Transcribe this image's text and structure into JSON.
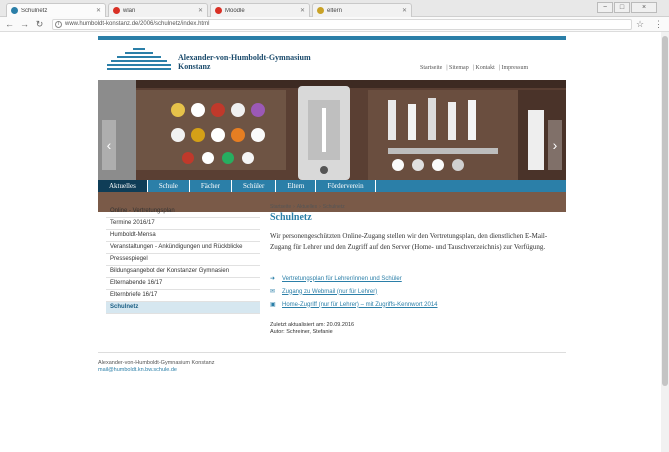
{
  "browser": {
    "tabs": [
      {
        "title": "Schulnetz",
        "color": "#2b7fa8",
        "active": true
      },
      {
        "title": "wlan",
        "color": "#d93025",
        "active": false
      },
      {
        "title": "Moodle",
        "color": "#d93025",
        "active": false
      },
      {
        "title": "eltern",
        "color": "#c9a227",
        "active": false
      }
    ],
    "address": "www.humboldt-konstanz.de/2006/schulnetz/index.html",
    "window_buttons": [
      "−",
      "□",
      "×"
    ]
  },
  "site": {
    "school_name_line1": "Alexander-von-Humboldt-Gymnasium",
    "school_name_line2": "Konstanz",
    "meta_links": [
      "Startseite",
      "Sitemap",
      "Kontakt",
      "Impressum"
    ],
    "nav": [
      "Aktuelles",
      "Schule",
      "Fächer",
      "Schüler",
      "Eltern",
      "Förderverein"
    ],
    "nav_active_index": 0
  },
  "sidebar": {
    "items": [
      {
        "label": "Online - Vertretungsplan",
        "active": false
      },
      {
        "label": "Termine 2016/17",
        "active": false
      },
      {
        "label": "Humboldt-Mensa",
        "active": false
      },
      {
        "label": "Veranstaltungen - Ankündigungen und Rückblicke",
        "active": false
      },
      {
        "label": "Pressespiegel",
        "active": false
      },
      {
        "label": "Bildungsangebot der Konstanzer Gymnasien",
        "active": false
      },
      {
        "label": "Elternabende 16/17",
        "active": false
      },
      {
        "label": "Elternbriefe 16/17",
        "active": false
      },
      {
        "label": "Schulnetz",
        "active": true
      }
    ]
  },
  "content": {
    "breadcrumb": [
      "Startseite",
      "Aktuelles",
      "Schulnetz"
    ],
    "title": "Schulnetz",
    "intro": "Wir personengeschützten Online-Zugang stellen wir den Vertretungsplan, den dienstlichen E-Mail-Zugang für Lehrer und den Zugriff auf den Server (Home- und Tauschverzeichnis) zur Verfügung.",
    "links": [
      {
        "icon": "link-icon",
        "label": "Vertretungsplan für Lehrer/innen und Schüler"
      },
      {
        "icon": "mail-icon",
        "label": "Zugang zu Webmail (nur für Lehrer)"
      },
      {
        "icon": "folder-icon",
        "label": "Home-Zugriff (nur für Lehrer) – mit Zugriffs-Kennwort 2014"
      }
    ],
    "last_changed": "Zuletzt aktualisiert am: 20.09.2016",
    "author": "Autor: Schreiner, Stefanie"
  },
  "footer": {
    "address": "Alexander-von-Humboldt-Gymnasium Konstanz",
    "email": "mail@humboldt.kn.bw.schule.de"
  },
  "colors": {
    "brand": "#2b7fa8",
    "nav_active": "#0f3d57",
    "sidebar_active": "#d6e7f0"
  }
}
